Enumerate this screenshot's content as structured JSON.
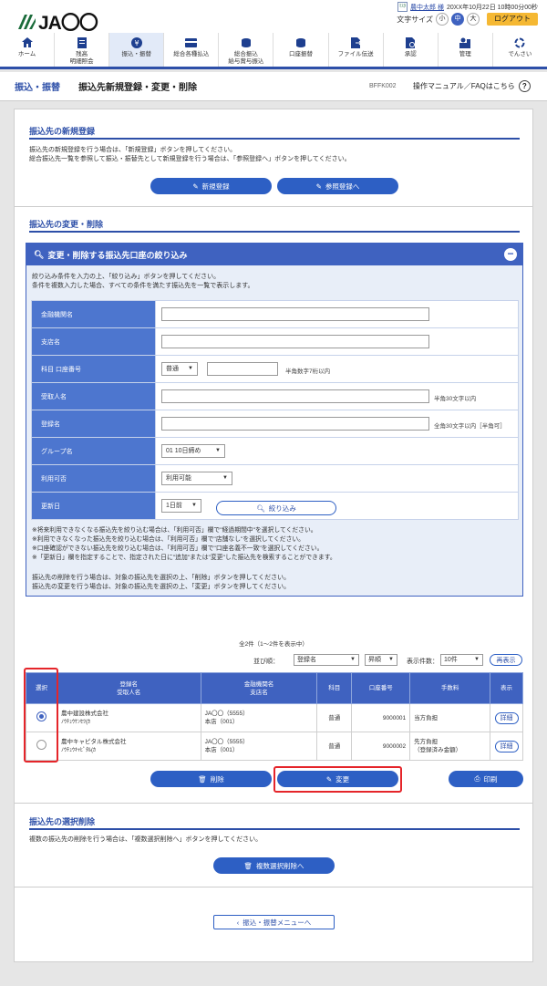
{
  "brand": {
    "logo_text": "JA〇〇"
  },
  "user": {
    "badge": "ﾏｽﾀ",
    "name": "農中太郎 様",
    "last_login": "20XX年10月22日 10時00分00秒"
  },
  "font_size": {
    "label": "文字サイズ",
    "small": "小",
    "medium": "中",
    "large": "大"
  },
  "logout_label": "ログアウト",
  "nav": {
    "home": "ホーム",
    "balance_a": "残高",
    "balance_b": "明細照会",
    "transfer": "振込・振替",
    "bulk": "総合各種払込",
    "bulk2_a": "総合振込",
    "bulk2_b": "給与賞与振込",
    "tax": "口座振替",
    "file": "ファイル伝送",
    "approval": "承認",
    "admin": "管理",
    "settings": "でんさい"
  },
  "header": {
    "section": "振込・振替",
    "title": "振込先新規登録・変更・削除",
    "code": "BFFK002",
    "help": "操作マニュアル／FAQはこちら"
  },
  "new_reg": {
    "title": "振込先の新規登録",
    "desc1": "振込先の新規登録を行う場合は、「新規登録」ボタンを押してください。",
    "desc2": "総合振込先一覧を参照して振込・振替先として新規登録を行う場合は、「参照登録へ」ボタンを押してください。",
    "btn_new": "新規登録",
    "btn_ref": "参照登録へ"
  },
  "change": {
    "title": "振込先の変更・削除",
    "filter_title": "変更・削除する振込先口座の絞り込み",
    "filter_desc1": "絞り込み条件を入力の上、「絞り込み」ボタンを押してください。",
    "filter_desc2": "条件を複数入力した場合、すべての条件を満たす振込先を一覧で表示します。",
    "fields": {
      "bank": "金融機関名",
      "branch": "支店名",
      "account": "科目 口座番号",
      "account_type": "普通",
      "account_hint": "半角数字7桁以内",
      "payee": "受取人名",
      "payee_hint": "半角30文字以内",
      "regname": "登録名",
      "regname_hint": "全角30文字以内［半角可］",
      "group": "グループ名",
      "group_value": "01 10日締め",
      "avail": "利用可否",
      "avail_value": "利用可能",
      "date": "更新日",
      "date_value": "1日前"
    },
    "btn_filter": "絞り込み",
    "notes": [
      "※将来利用できなくなる振込先を絞り込む場合は、「利用可否」欄で\"経過期間中\"を選択してください。",
      "※利用できなくなった振込先を絞り込む場合は、「利用可否」欄で\"店舗なし\"を選択してください。",
      "※口座確認ができない振込先を絞り込む場合は、「利用可否」欄で\"口座名義不一致\"を選択してください。",
      "※「更新日」欄を指定することで、指定された日に\"追加\"または\"変更\"した振込先を検索することができます。"
    ],
    "desc_del": "振込先の削除を行う場合は、対象の振込先を選択の上、「削除」ボタンを押してください。",
    "desc_chg": "振込先の変更を行う場合は、対象の振込先を選択の上、「変更」ボタンを押してください。",
    "count": "全2件（1～2件を表示中）",
    "sort_label": "並び順：",
    "sort_value": "登録名",
    "order_value": "昇順",
    "per_label": "表示件数：",
    "per_value": "10件",
    "btn_redisplay": "再表示",
    "cols": {
      "select": "選択",
      "reg_a": "登録名",
      "reg_b": "受取人名",
      "bank_a": "金融機関名",
      "bank_b": "支店名",
      "type": "科目",
      "acct": "口座番号",
      "fee": "手数料",
      "show": "表示"
    },
    "rows": [
      {
        "reg": "農中建設株式会社",
        "kana": "ﾉｳﾁｭｳｹﾝｾﾂ(ｶ",
        "bank": "JA〇〇（5555）",
        "branch": "本店（001）",
        "type": "普通",
        "acct": "9000001",
        "fee": "当方負担",
        "fee2": "",
        "detail": "詳細"
      },
      {
        "reg": "農中キャピタル株式会社",
        "kana": "ﾉｳﾁｭｳｷｬﾋﾟﾀﾙ(ｶ",
        "bank": "JA〇〇（5555）",
        "branch": "本店（001）",
        "type": "普通",
        "acct": "9000002",
        "fee": "先方負担",
        "fee2": "（登録済み金額）",
        "detail": "詳細"
      }
    ],
    "btn_delete": "削除",
    "btn_change": "変更",
    "btn_print": "印刷"
  },
  "bulk_del": {
    "title": "振込先の選択削除",
    "desc": "複数の振込先の削除を行う場合は、「複数選択削除へ」ボタンを押してください。",
    "btn": "複数選択削除へ"
  },
  "back": {
    "btn": "振込・振替メニューへ"
  }
}
